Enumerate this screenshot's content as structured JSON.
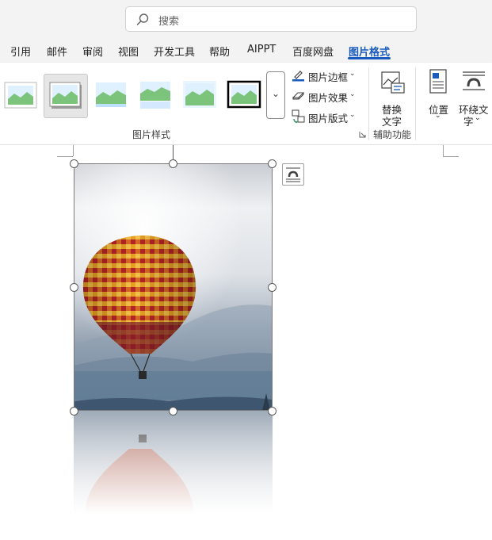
{
  "search": {
    "placeholder": "搜索"
  },
  "tabs": [
    {
      "label": "引用"
    },
    {
      "label": "邮件"
    },
    {
      "label": "审阅"
    },
    {
      "label": "视图"
    },
    {
      "label": "开发工具"
    },
    {
      "label": "帮助"
    },
    {
      "label": "AIPPT"
    },
    {
      "label": "百度网盘"
    },
    {
      "label": "图片格式",
      "active": true
    }
  ],
  "ribbon": {
    "picture_styles": {
      "group_label": "图片样式",
      "more_glyph": "⌄",
      "commands": {
        "border": "图片边框",
        "effects": "图片效果",
        "layout": "图片版式"
      }
    },
    "accessibility": {
      "group_label": "辅助功能",
      "alt_text_line1": "替换",
      "alt_text_line2": "文字"
    },
    "arrange": {
      "position_label": "位置",
      "wrap_line1": "环绕文",
      "wrap_line2": "字"
    },
    "chevron": "⌄"
  },
  "colors": {
    "accent": "#185abd",
    "ribbon_bg": "#f3f3f3",
    "balloon_red": "#c0392b",
    "balloon_orange": "#f39c12"
  }
}
